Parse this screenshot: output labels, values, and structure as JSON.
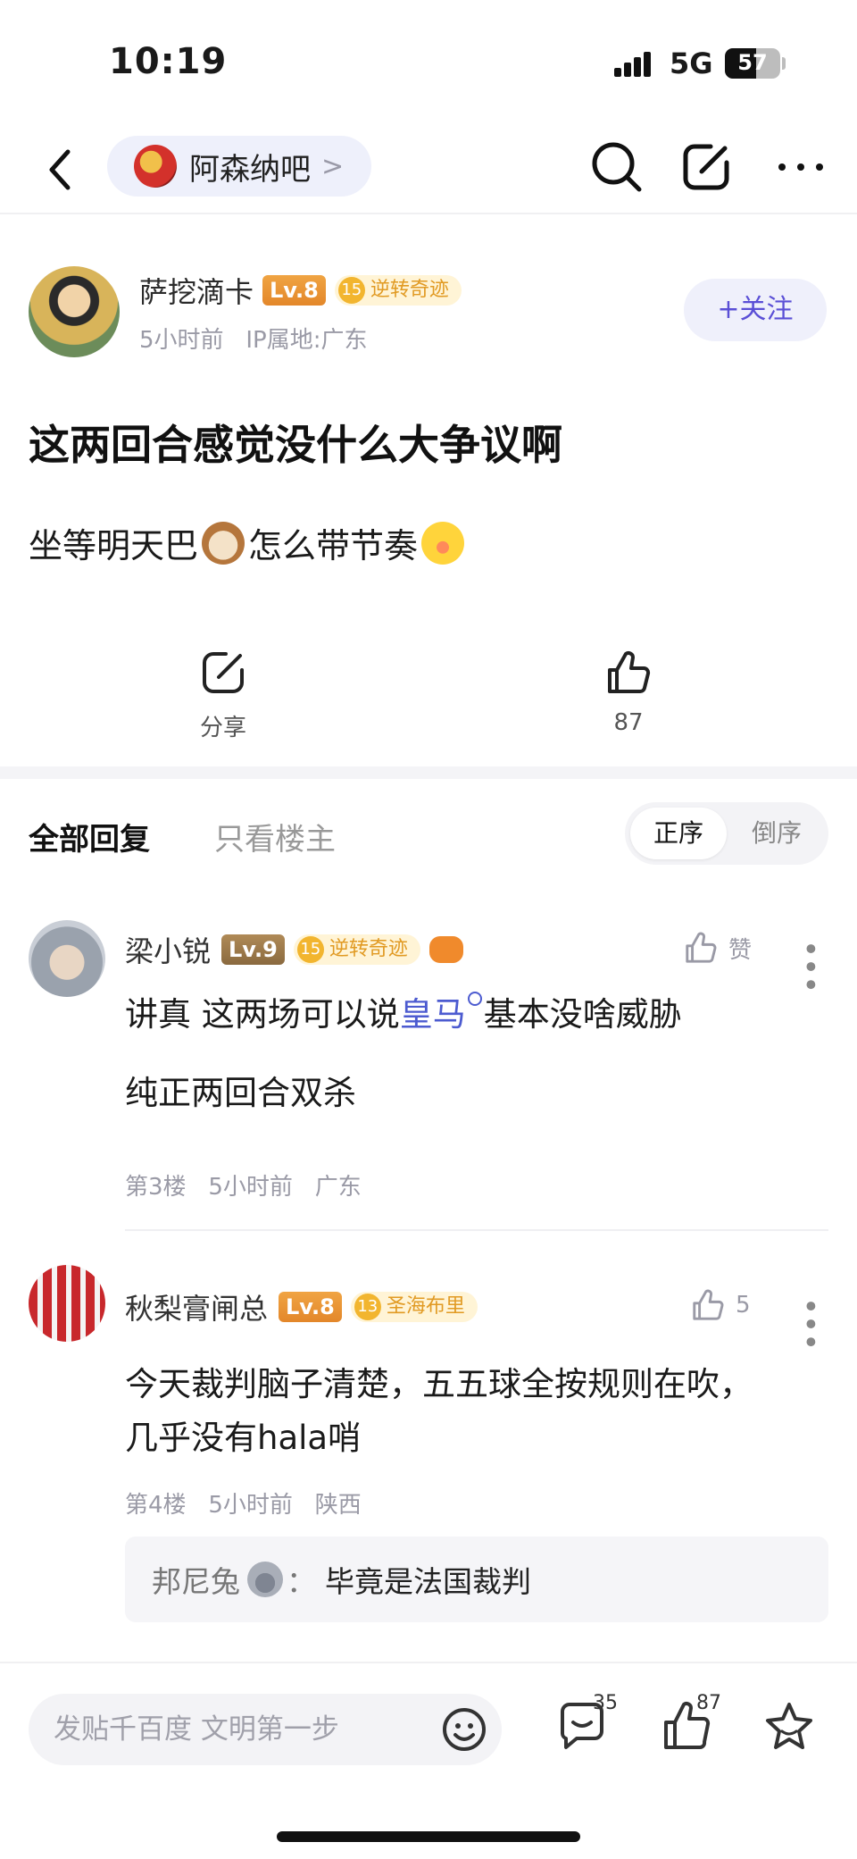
{
  "status_bar": {
    "time": "10:19",
    "network": "5G",
    "battery": 57
  },
  "nav": {
    "forum_name": "阿森纳吧",
    "forum_arrow": ">"
  },
  "post": {
    "author": "萨挖滴卡",
    "author_level": "Lv.8",
    "author_title_level": "15",
    "author_title": "逆转奇迹",
    "time_ago": "5小时前",
    "ip": "IP属地:广东",
    "follow_label": "+关注",
    "title": "这两回合感觉没什么大争议啊",
    "body_part1": "坐等明天巴",
    "body_part2": "怎么带节奏",
    "share_label": "分享",
    "like_count": "87"
  },
  "replies_header": {
    "tab_all": "全部回复",
    "tab_owner": "只看楼主",
    "sort_asc": "正序",
    "sort_desc": "倒序"
  },
  "comments": [
    {
      "name": "梁小锐",
      "level": "Lv.9",
      "title_level": "15",
      "title": "逆转奇迹",
      "like_label": "赞",
      "text_line1_a": "讲真 这两场可以说",
      "text_line1_link": "皇马",
      "text_line1_b": "基本没啥威胁",
      "text_line2": "纯正两回合双杀",
      "floor": "第3楼",
      "time_ago": "5小时前",
      "location": "广东"
    },
    {
      "name": "秋梨膏闸总",
      "level": "Lv.8",
      "title_level": "13",
      "title": "圣海布里",
      "like_count": "5",
      "text_line1": "今天裁判脑子清楚，五五球全按规则在吹，",
      "text_line2": "几乎没有hala哨",
      "floor": "第4楼",
      "time_ago": "5小时前",
      "location": "陕西",
      "sub_reply": {
        "name": "邦尼兔",
        "sep": "：",
        "text": "毕竟是法国裁判"
      }
    }
  ],
  "bottom_bar": {
    "compose_placeholder": "发贴千百度 文明第一步",
    "comment_count": "35",
    "like_count": "87"
  },
  "colors": {
    "accent": "#5a4fd6",
    "link": "#4c5bd0",
    "gold": "#e19a23"
  }
}
